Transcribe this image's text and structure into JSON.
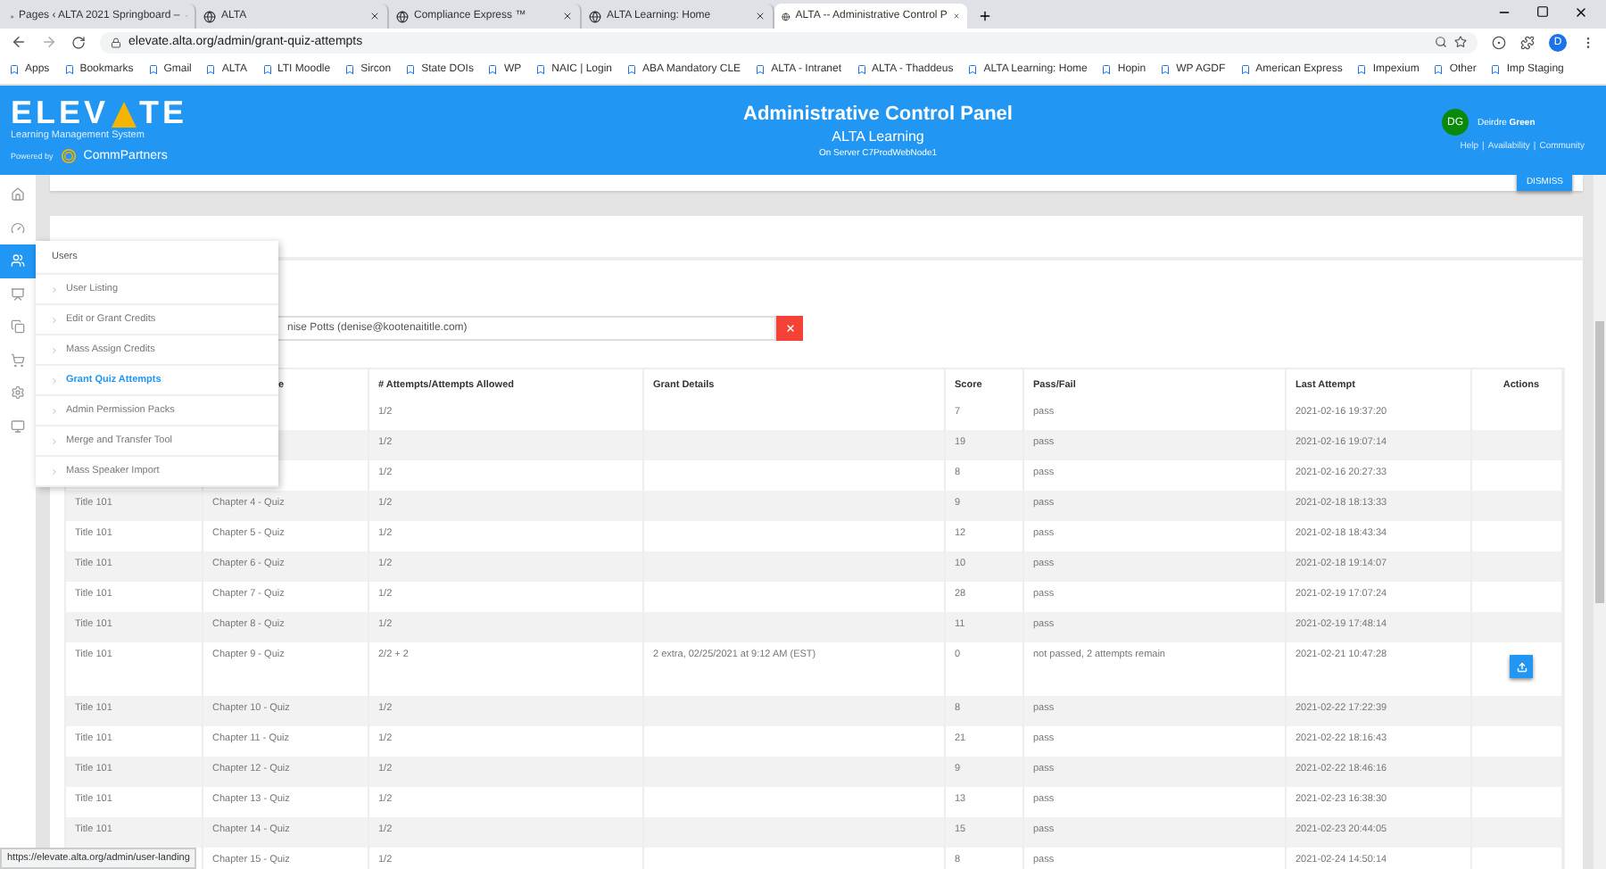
{
  "browser": {
    "tabs": [
      {
        "title": "Pages ‹ ALTA 2021 Springboard –",
        "selected": false
      },
      {
        "title": "ALTA",
        "selected": false
      },
      {
        "title": "Compliance Express ™",
        "selected": false
      },
      {
        "title": "ALTA Learning: Home",
        "selected": false
      },
      {
        "title": "ALTA -- Administrative Control P",
        "selected": true
      }
    ],
    "url": "elevate.alta.org/admin/grant-quiz-attempts",
    "profile": "D",
    "bookmarks": [
      "Apps",
      "Bookmarks",
      "Gmail",
      "ALTA",
      "LTI Moodle",
      "Sircon",
      "State DOIs",
      "WP",
      "NAIC | Login",
      "ABA Mandatory CLE",
      "ALTA - Intranet",
      "ALTA - Thaddeus",
      "ALTA Learning: Home",
      "Hopin",
      "WP AGDF",
      "American Express",
      "Impexium",
      "Other",
      "Imp Staging"
    ]
  },
  "header": {
    "logo_start": "ELEV",
    "logo_end": "TE",
    "tagline": "Learning Management System",
    "powered_by": "Powered by",
    "partner": "CommPartners",
    "title": "Administrative Control Panel",
    "subtitle": "ALTA Learning",
    "server": "On Server C7ProdWebNode1",
    "user": {
      "initials": "DG",
      "first": "Deirdre",
      "last": "Green",
      "links": [
        "Help",
        "Availability",
        "Community"
      ],
      "separator": "|"
    }
  },
  "rail": [
    {
      "kind": "home",
      "selected": false
    },
    {
      "kind": "gauge",
      "selected": false
    },
    {
      "kind": "users",
      "selected": true
    },
    {
      "kind": "board",
      "selected": false
    },
    {
      "kind": "copy",
      "selected": false
    },
    {
      "kind": "cart",
      "selected": false
    },
    {
      "kind": "gear",
      "selected": false
    },
    {
      "kind": "monitor",
      "selected": false
    }
  ],
  "notice": {
    "button": "DISMISS"
  },
  "menu": {
    "title": "Users",
    "items": [
      {
        "label": "User Listing",
        "selected": false
      },
      {
        "label": "Edit or Grant Credits",
        "selected": false
      },
      {
        "label": "Mass Assign Credits",
        "selected": false
      },
      {
        "label": "Grant Quiz Attempts",
        "selected": true
      },
      {
        "label": "Admin Permission Packs",
        "selected": false
      },
      {
        "label": "Merge and Transfer Tool",
        "selected": false
      },
      {
        "label": "Mass Speaker Import",
        "selected": false
      }
    ]
  },
  "search": {
    "value": "nise Potts (denise@kootenaititle.com)"
  },
  "table": {
    "columns": [
      "e",
      "# Attempts/Attempts Allowed",
      "Grant Details",
      "Score",
      "Pass/Fail",
      "Last Attempt",
      "Actions"
    ],
    "rows": [
      {
        "attempts": "1/2",
        "score": "7",
        "result": "pass",
        "last": "2021-02-16 19:37:20",
        "action": false
      },
      {
        "attempts": "1/2",
        "score": "19",
        "result": "pass",
        "last": "2021-02-16 19:07:14",
        "action": false
      },
      {
        "attempts": "1/2",
        "score": "8",
        "result": "pass",
        "last": "2021-02-16 20:27:33",
        "action": false
      },
      {
        "course": "Title 101",
        "quiz": "Chapter 4 - Quiz",
        "attempts": "1/2",
        "score": "9",
        "result": "pass",
        "last": "2021-02-18 18:13:33",
        "action": false
      },
      {
        "course": "Title 101",
        "quiz": "Chapter 5 - Quiz",
        "attempts": "1/2",
        "score": "12",
        "result": "pass",
        "last": "2021-02-18 18:43:34",
        "action": false
      },
      {
        "course": "Title 101",
        "quiz": "Chapter 6 - Quiz",
        "attempts": "1/2",
        "score": "10",
        "result": "pass",
        "last": "2021-02-18 19:14:07",
        "action": false
      },
      {
        "course": "Title 101",
        "quiz": "Chapter 7 - Quiz",
        "attempts": "1/2",
        "score": "28",
        "result": "pass",
        "last": "2021-02-19 17:07:24",
        "action": false
      },
      {
        "course": "Title 101",
        "quiz": "Chapter 8 - Quiz",
        "attempts": "1/2",
        "score": "11",
        "result": "pass",
        "last": "2021-02-19 17:48:14",
        "action": false
      },
      {
        "course": "Title 101",
        "quiz": "Chapter 9 - Quiz",
        "attempts": "2/2 + 2",
        "grant": "2 extra, 02/25/2021 at 9:12 AM (EST)",
        "score": "0",
        "result": "not passed, 2 attempts remain",
        "last": "2021-02-21 10:47:28",
        "action": true
      },
      {
        "course": "Title 101",
        "quiz": "Chapter 10 - Quiz",
        "attempts": "1/2",
        "score": "8",
        "result": "pass",
        "last": "2021-02-22 17:22:39",
        "action": false
      },
      {
        "course": "Title 101",
        "quiz": "Chapter 11 - Quiz",
        "attempts": "1/2",
        "score": "21",
        "result": "pass",
        "last": "2021-02-22 18:16:43",
        "action": false
      },
      {
        "course": "Title 101",
        "quiz": "Chapter 12 - Quiz",
        "attempts": "1/2",
        "score": "9",
        "result": "pass",
        "last": "2021-02-22 18:46:16",
        "action": false
      },
      {
        "course": "Title 101",
        "quiz": "Chapter 13 - Quiz",
        "attempts": "1/2",
        "score": "13",
        "result": "pass",
        "last": "2021-02-23 16:38:30",
        "action": false
      },
      {
        "course": "Title 101",
        "quiz": "Chapter 14 - Quiz",
        "attempts": "1/2",
        "score": "15",
        "result": "pass",
        "last": "2021-02-23 20:44:05",
        "action": false
      },
      {
        "quiz": "Chapter 15 - Quiz",
        "attempts": "1/2",
        "score": "8",
        "result": "pass",
        "last": "2021-02-24 14:50:14",
        "action": false
      }
    ]
  },
  "status_url": "https://elevate.alta.org/admin/user-landing"
}
